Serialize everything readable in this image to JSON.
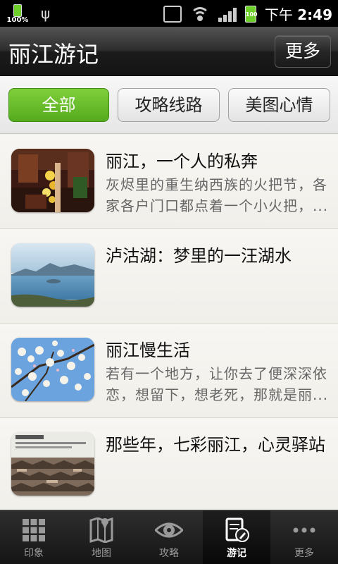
{
  "statusbar": {
    "battery_small_pct": "100%",
    "battery_level": "100",
    "time_prefix": "下午",
    "time": "2:49"
  },
  "header": {
    "title": "丽江游记",
    "more_label": "更多"
  },
  "filters": [
    {
      "label": "全部",
      "active": true
    },
    {
      "label": "攻略线路",
      "active": false
    },
    {
      "label": "美图心情",
      "active": false
    }
  ],
  "articles": [
    {
      "title": "丽江，一个人的私奔",
      "desc_line1": "灰烬里的重生纳西族的火把节，各",
      "desc_line2": "家各户门口都点着一个小火把，..."
    },
    {
      "title": "泸沽湖：梦里的一汪湖水",
      "desc_line1": "",
      "desc_line2": ""
    },
    {
      "title": "丽江慢生活",
      "desc_line1": "若有一个地方，让你去了便深深依",
      "desc_line2": "恋，想留下，想老死，那就是丽..."
    },
    {
      "title": "那些年，七彩丽江，心灵驿站",
      "desc_line1": "",
      "desc_line2": ""
    }
  ],
  "tabs": [
    {
      "label": "印象",
      "icon": "grid-icon"
    },
    {
      "label": "地图",
      "icon": "map-icon"
    },
    {
      "label": "攻略",
      "icon": "eye-icon"
    },
    {
      "label": "游记",
      "icon": "edit-icon"
    },
    {
      "label": "更多",
      "icon": "more-dots-icon"
    }
  ],
  "colors": {
    "accent_green": "#5db524",
    "header_dark": "#1b1b1b",
    "tab_active": "#0a0a0a"
  }
}
